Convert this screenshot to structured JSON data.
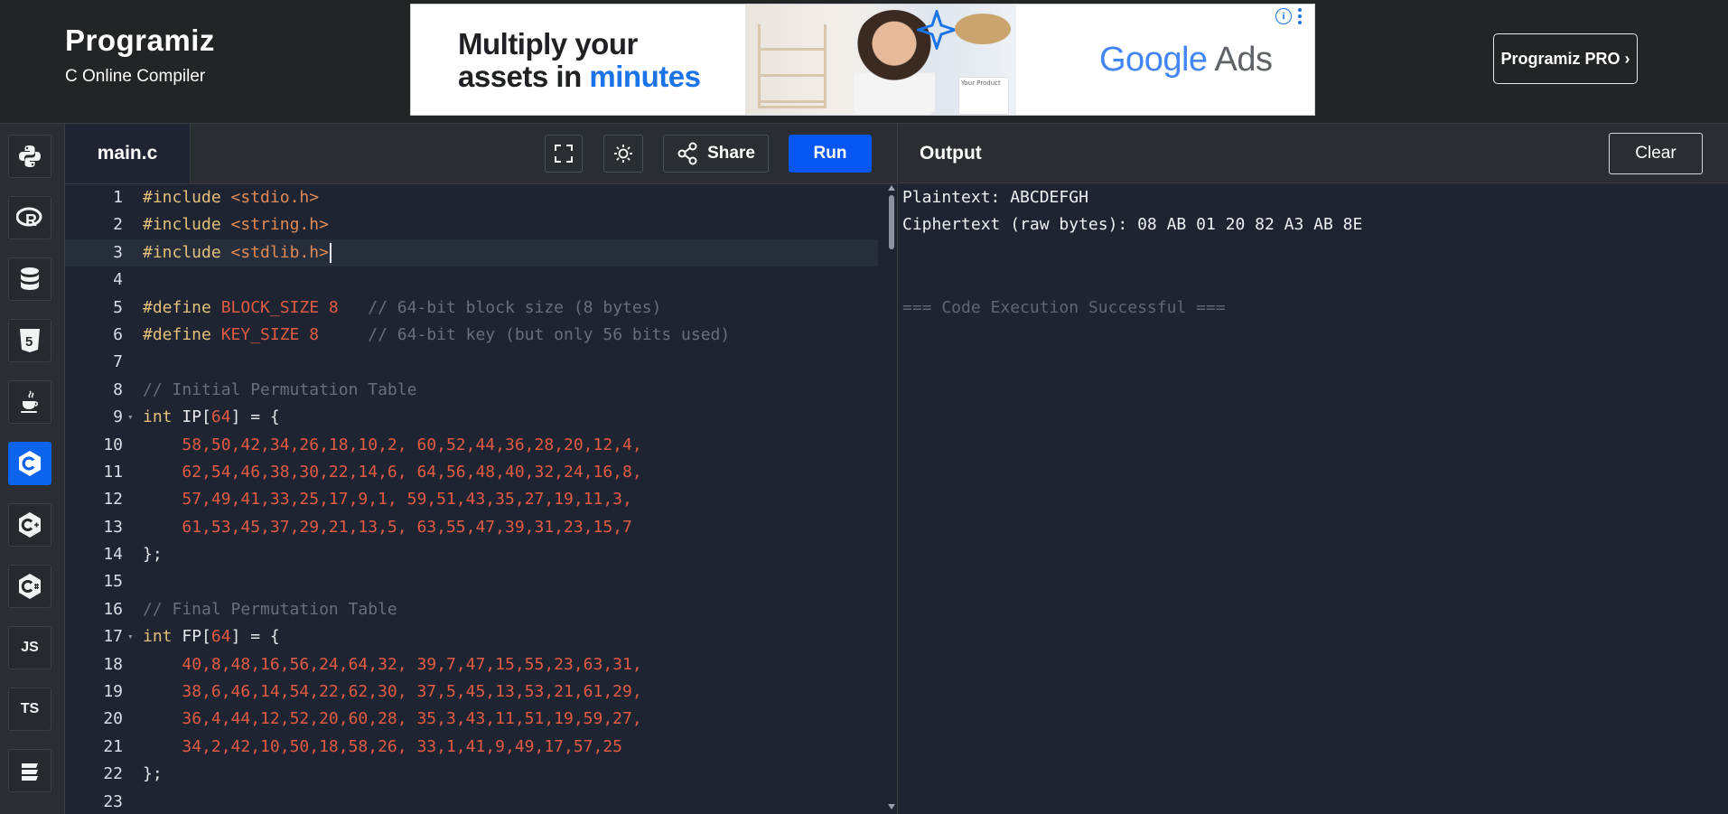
{
  "header": {
    "logo_text": "Programiz",
    "subtitle": "C Online Compiler",
    "pro_button_label": "Programiz PRO ›"
  },
  "ad": {
    "headline_line1": "Multiply your",
    "headline_line2_prefix": "assets in ",
    "headline_line2_accent": "minutes",
    "product_card_text": "Your Product",
    "logo_word": "Google",
    "logo_suffix": "Ads",
    "info_glyph": "i"
  },
  "sidebar": {
    "items": [
      {
        "name": "python",
        "icon": "python-icon"
      },
      {
        "name": "r",
        "icon": "r-icon",
        "glyph": "R"
      },
      {
        "name": "sql",
        "icon": "database-icon"
      },
      {
        "name": "html",
        "icon": "html5-icon",
        "glyph": "5"
      },
      {
        "name": "java",
        "icon": "java-cup-icon"
      },
      {
        "name": "c",
        "icon": "c-icon",
        "active": true
      },
      {
        "name": "cpp",
        "icon": "cpp-icon"
      },
      {
        "name": "csharp",
        "icon": "csharp-icon"
      },
      {
        "name": "js",
        "icon": "js-icon",
        "glyph": "JS"
      },
      {
        "name": "ts",
        "icon": "ts-icon",
        "glyph": "TS"
      },
      {
        "name": "swift",
        "icon": "swift-icon"
      }
    ]
  },
  "editor": {
    "file_tab": "main.c",
    "share_label": "Share",
    "run_label": "Run",
    "current_line": 3,
    "lines": [
      {
        "n": "1",
        "tokens": [
          {
            "t": "pre",
            "v": "#include "
          },
          {
            "t": "inc",
            "v": "<stdio.h>"
          }
        ]
      },
      {
        "n": "2",
        "tokens": [
          {
            "t": "pre",
            "v": "#include "
          },
          {
            "t": "inc",
            "v": "<string.h>"
          }
        ]
      },
      {
        "n": "3",
        "tokens": [
          {
            "t": "pre",
            "v": "#include "
          },
          {
            "t": "inc",
            "v": "<stdlib.h>"
          }
        ]
      },
      {
        "n": "4",
        "tokens": []
      },
      {
        "n": "5",
        "tokens": [
          {
            "t": "pre",
            "v": "#define "
          },
          {
            "t": "mac",
            "v": "BLOCK_SIZE 8"
          },
          {
            "t": "txt",
            "v": "   "
          },
          {
            "t": "cmt",
            "v": "// 64-bit block size (8 bytes)"
          }
        ]
      },
      {
        "n": "6",
        "tokens": [
          {
            "t": "pre",
            "v": "#define "
          },
          {
            "t": "mac",
            "v": "KEY_SIZE 8"
          },
          {
            "t": "txt",
            "v": "     "
          },
          {
            "t": "cmt",
            "v": "// 64-bit key (but only 56 bits used)"
          }
        ]
      },
      {
        "n": "7",
        "tokens": []
      },
      {
        "n": "8",
        "tokens": [
          {
            "t": "cmt",
            "v": "// Initial Permutation Table"
          }
        ]
      },
      {
        "n": "9",
        "fold": true,
        "tokens": [
          {
            "t": "kw",
            "v": "int "
          },
          {
            "t": "txt",
            "v": "IP["
          },
          {
            "t": "num",
            "v": "64"
          },
          {
            "t": "txt",
            "v": "] = {"
          }
        ]
      },
      {
        "n": "10",
        "tokens": [
          {
            "t": "txt",
            "v": "    "
          },
          {
            "t": "num",
            "v": "58,50,42,34,26,18,10,2, 60,52,44,36,28,20,12,4,"
          }
        ]
      },
      {
        "n": "11",
        "tokens": [
          {
            "t": "txt",
            "v": "    "
          },
          {
            "t": "num",
            "v": "62,54,46,38,30,22,14,6, 64,56,48,40,32,24,16,8,"
          }
        ]
      },
      {
        "n": "12",
        "tokens": [
          {
            "t": "txt",
            "v": "    "
          },
          {
            "t": "num",
            "v": "57,49,41,33,25,17,9,1, 59,51,43,35,27,19,11,3,"
          }
        ]
      },
      {
        "n": "13",
        "tokens": [
          {
            "t": "txt",
            "v": "    "
          },
          {
            "t": "num",
            "v": "61,53,45,37,29,21,13,5, 63,55,47,39,31,23,15,7"
          }
        ]
      },
      {
        "n": "14",
        "tokens": [
          {
            "t": "txt",
            "v": "};"
          }
        ]
      },
      {
        "n": "15",
        "tokens": []
      },
      {
        "n": "16",
        "tokens": [
          {
            "t": "cmt",
            "v": "// Final Permutation Table"
          }
        ]
      },
      {
        "n": "17",
        "fold": true,
        "tokens": [
          {
            "t": "kw",
            "v": "int "
          },
          {
            "t": "txt",
            "v": "FP["
          },
          {
            "t": "num",
            "v": "64"
          },
          {
            "t": "txt",
            "v": "] = {"
          }
        ]
      },
      {
        "n": "18",
        "tokens": [
          {
            "t": "txt",
            "v": "    "
          },
          {
            "t": "num",
            "v": "40,8,48,16,56,24,64,32, 39,7,47,15,55,23,63,31,"
          }
        ]
      },
      {
        "n": "19",
        "tokens": [
          {
            "t": "txt",
            "v": "    "
          },
          {
            "t": "num",
            "v": "38,6,46,14,54,22,62,30, 37,5,45,13,53,21,61,29,"
          }
        ]
      },
      {
        "n": "20",
        "tokens": [
          {
            "t": "txt",
            "v": "    "
          },
          {
            "t": "num",
            "v": "36,4,44,12,52,20,60,28, 35,3,43,11,51,19,59,27,"
          }
        ]
      },
      {
        "n": "21",
        "tokens": [
          {
            "t": "txt",
            "v": "    "
          },
          {
            "t": "num",
            "v": "34,2,42,10,50,18,58,26, 33,1,41,9,49,17,57,25"
          }
        ]
      },
      {
        "n": "22",
        "tokens": [
          {
            "t": "txt",
            "v": "};"
          }
        ]
      },
      {
        "n": "23",
        "tokens": []
      }
    ]
  },
  "output": {
    "title": "Output",
    "clear_label": "Clear",
    "lines": [
      {
        "text": "Plaintext: ABCDEFGH",
        "muted": false
      },
      {
        "text": "Ciphertext (raw bytes): 08 AB 01 20 82 A3 AB 8E",
        "muted": false
      },
      {
        "text": "",
        "muted": false
      },
      {
        "text": "",
        "muted": false
      },
      {
        "text": "=== Code Execution Successful ===",
        "muted": true
      }
    ]
  },
  "colors": {
    "run_button": "#0556f3",
    "active_language": "#0c63ee",
    "editor_bg": "#1e2431",
    "number": "#e05b43",
    "comment": "#676f7e",
    "keyword": "#e5c07b"
  }
}
